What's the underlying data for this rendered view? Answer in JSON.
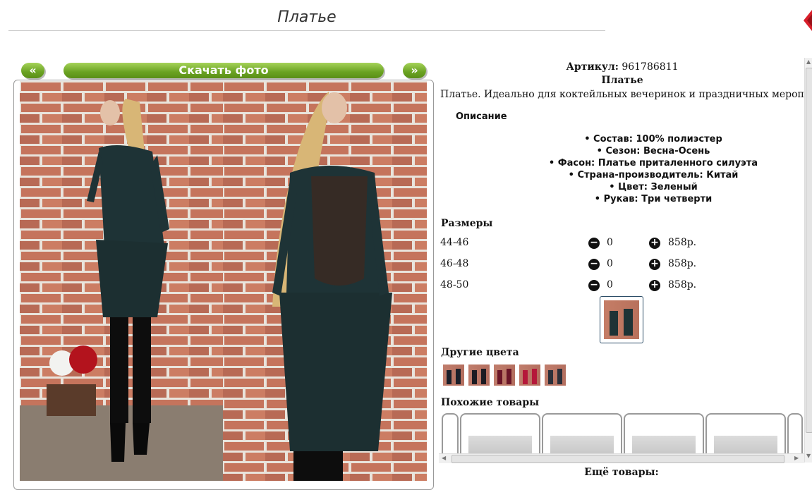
{
  "page": {
    "title": "Платье"
  },
  "gallery": {
    "prev_label": "«",
    "next_label": "»",
    "download_label": "Скачать фото"
  },
  "product": {
    "article_label": "Артикул:",
    "article_value": "961786811",
    "name": "Платье",
    "description": "Платье. Идеально для коктейльных вечеринок и праздничных мероприятий",
    "description_heading": "Описание",
    "properties": [
      "Состав: 100% полиэстер",
      "Сезон: Весна-Осень",
      "Фасон: Платье приталенного силуэта",
      "Страна-производитель: Китай",
      "Цвет: Зеленый",
      "Рукав: Три четверти"
    ]
  },
  "sizes": {
    "heading": "Размеры",
    "rows": [
      {
        "label": "44-46",
        "qty": "0",
        "price": "858р."
      },
      {
        "label": "46-48",
        "qty": "0",
        "price": "858р."
      },
      {
        "label": "48-50",
        "qty": "0",
        "price": "858р."
      }
    ]
  },
  "colors": {
    "heading": "Другие цвета"
  },
  "similar": {
    "heading": "Похожие товары"
  },
  "more": {
    "label": "Ещё товары:"
  },
  "icons": {
    "minus": "minus-circle-icon",
    "plus": "plus-circle-icon",
    "close": "close-icon"
  },
  "accent": {
    "button_green": "#6aa222",
    "close_red": "#d81e2a"
  }
}
